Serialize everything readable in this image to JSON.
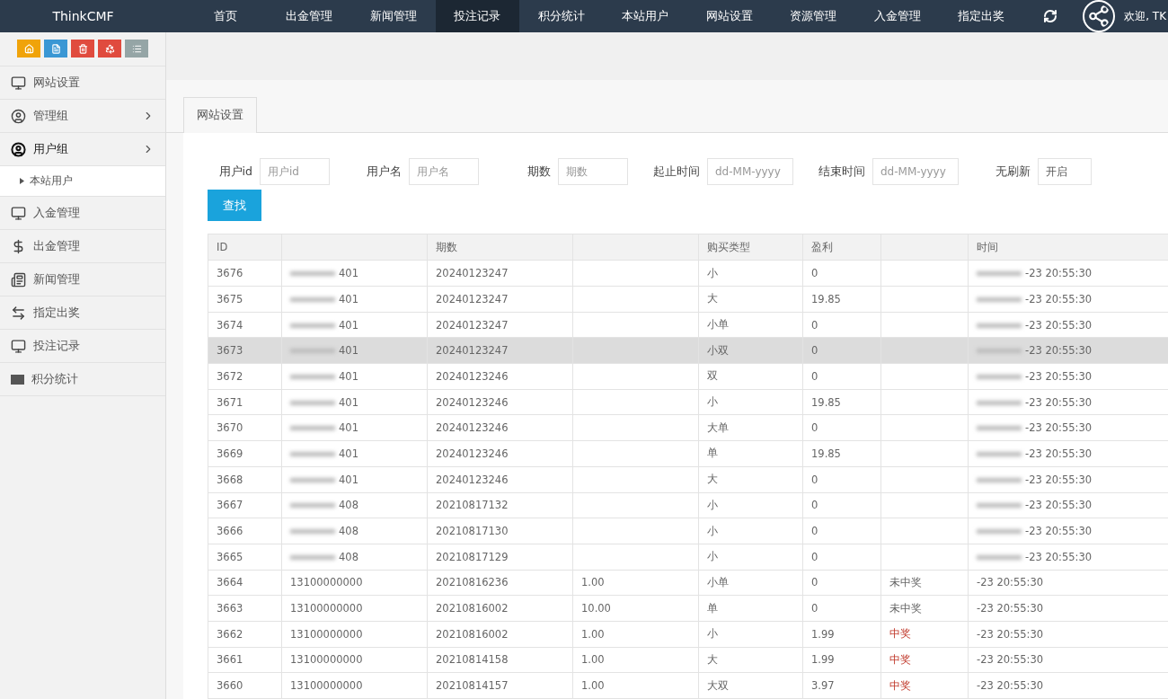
{
  "topbar": {
    "brand": "ThinkCMF",
    "nav": [
      {
        "label": "首页",
        "selected": false
      },
      {
        "label": "出金管理",
        "selected": false
      },
      {
        "label": "新闻管理",
        "selected": false
      },
      {
        "label": "投注记录",
        "selected": true
      },
      {
        "label": "积分统计",
        "selected": false
      },
      {
        "label": "本站用户",
        "selected": false
      },
      {
        "label": "网站设置",
        "selected": false
      },
      {
        "label": "资源管理",
        "selected": false
      },
      {
        "label": "入金管理",
        "selected": false
      },
      {
        "label": "指定出奖",
        "selected": false
      }
    ],
    "welcome": "欢迎, TK"
  },
  "sidebar": {
    "shortcuts": [
      {
        "kind": "home",
        "color": "#f0a30a"
      },
      {
        "kind": "file",
        "color": "#3a97d4"
      },
      {
        "kind": "trash",
        "color": "#e04b3e"
      },
      {
        "kind": "recycle",
        "color": "#e04b3e"
      },
      {
        "kind": "list",
        "color": "#95a5a6"
      }
    ],
    "items": [
      {
        "kind": "monitor",
        "label": "网站设置",
        "expandable": false,
        "expanded": false
      },
      {
        "kind": "user",
        "label": "管理组",
        "expandable": true,
        "expanded": false
      },
      {
        "kind": "user-bold",
        "label": "用户组",
        "expandable": true,
        "expanded": true,
        "children": [
          {
            "label": "本站用户"
          }
        ]
      },
      {
        "kind": "monitor",
        "label": "入金管理",
        "expandable": false,
        "expanded": false
      },
      {
        "kind": "dollar",
        "label": "出金管理",
        "expandable": false,
        "expanded": false
      },
      {
        "kind": "news",
        "label": "新闻管理",
        "expandable": false,
        "expanded": false
      },
      {
        "kind": "swap",
        "label": "指定出奖",
        "expandable": false,
        "expanded": false
      },
      {
        "kind": "monitor",
        "label": "投注记录",
        "expandable": false,
        "expanded": false
      },
      {
        "kind": "visa",
        "label": "积分统计",
        "expandable": false,
        "expanded": false
      }
    ]
  },
  "tabs": [
    {
      "label": "网站设置",
      "selected": true
    }
  ],
  "filters": [
    {
      "label": "用户id",
      "placeholder": "用户id"
    },
    {
      "label": "用户名",
      "placeholder": "用户名"
    },
    {
      "label": "期数",
      "placeholder": "期数"
    },
    {
      "label": "起止时间",
      "placeholder": "dd-MM-yyyy"
    },
    {
      "label": "结束时间",
      "placeholder": "dd-MM-yyyy"
    },
    {
      "label": "无刷新",
      "value": "开启"
    }
  ],
  "search_button": "查找",
  "table": {
    "columns": [
      "ID",
      null,
      "期数",
      null,
      "购买类型",
      "盈利",
      null,
      "时间"
    ],
    "rows": [
      {
        "masked": true,
        "selected": false,
        "cells": [
          "3676",
          "401",
          "20240123247",
          "",
          "小",
          "0",
          "",
          "-23 20:55:30"
        ]
      },
      {
        "masked": true,
        "selected": false,
        "cells": [
          "3675",
          "401",
          "20240123247",
          "",
          "大",
          "19.85",
          "",
          "-23 20:55:30"
        ]
      },
      {
        "masked": true,
        "selected": false,
        "cells": [
          "3674",
          "401",
          "20240123247",
          "",
          "小单",
          "0",
          "",
          "-23 20:55:30"
        ]
      },
      {
        "masked": true,
        "selected": true,
        "cells": [
          "3673",
          "401",
          "20240123247",
          "",
          "小双",
          "0",
          "",
          "-23 20:55:30"
        ]
      },
      {
        "masked": true,
        "selected": false,
        "cells": [
          "3672",
          "401",
          "20240123246",
          "",
          "双",
          "0",
          "",
          "-23 20:55:30"
        ]
      },
      {
        "masked": true,
        "selected": false,
        "cells": [
          "3671",
          "401",
          "20240123246",
          "",
          "小",
          "19.85",
          "",
          "-23 20:55:30"
        ]
      },
      {
        "masked": true,
        "selected": false,
        "cells": [
          "3670",
          "401",
          "20240123246",
          "",
          "大单",
          "0",
          "",
          "-23 20:55:30"
        ]
      },
      {
        "masked": true,
        "selected": false,
        "cells": [
          "3669",
          "401",
          "20240123246",
          "",
          "单",
          "19.85",
          "",
          "-23 20:55:30"
        ]
      },
      {
        "masked": true,
        "selected": false,
        "cells": [
          "3668",
          "401",
          "20240123246",
          "",
          "大",
          "0",
          "",
          "-23 20:55:30"
        ]
      },
      {
        "masked": true,
        "selected": false,
        "cells": [
          "3667",
          "408",
          "20210817132",
          "",
          "小",
          "0",
          "",
          "-23 20:55:30"
        ]
      },
      {
        "masked": true,
        "selected": false,
        "cells": [
          "3666",
          "408",
          "20210817130",
          "",
          "小",
          "0",
          "",
          "-23 20:55:30"
        ]
      },
      {
        "masked": true,
        "selected": false,
        "cells": [
          "3665",
          "408",
          "20210817129",
          "",
          "小",
          "0",
          "",
          "-23 20:55:30"
        ]
      },
      {
        "masked": false,
        "selected": false,
        "won": false,
        "cells": [
          "3664",
          "13100000000",
          "20210816236",
          "1.00",
          "小单",
          "0",
          "未中奖",
          "-23 20:55:30"
        ]
      },
      {
        "masked": false,
        "selected": false,
        "won": false,
        "cells": [
          "3663",
          "13100000000",
          "20210816002",
          "10.00",
          "单",
          "0",
          "未中奖",
          "-23 20:55:30"
        ]
      },
      {
        "masked": false,
        "selected": false,
        "won": true,
        "cells": [
          "3662",
          "13100000000",
          "20210816002",
          "1.00",
          "小",
          "1.99",
          "中奖",
          "-23 20:55:30"
        ]
      },
      {
        "masked": false,
        "selected": false,
        "won": true,
        "cells": [
          "3661",
          "13100000000",
          "20210814158",
          "1.00",
          "大",
          "1.99",
          "中奖",
          "-23 20:55:30"
        ]
      },
      {
        "masked": false,
        "selected": false,
        "won": true,
        "cells": [
          "3660",
          "13100000000",
          "20210814157",
          "1.00",
          "大双",
          "3.97",
          "中奖",
          "-23 20:55:30"
        ]
      }
    ]
  }
}
